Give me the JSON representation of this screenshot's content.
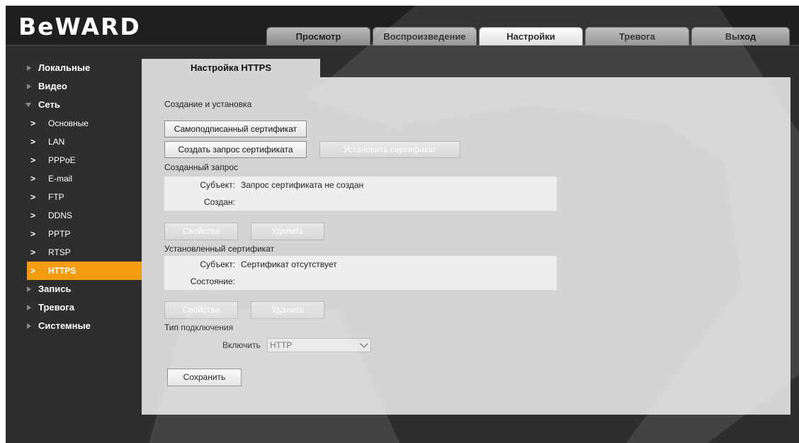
{
  "logo": "BeWARD",
  "tabs": [
    {
      "label": "Просмотр",
      "active": false
    },
    {
      "label": "Воспроизведение",
      "active": false
    },
    {
      "label": "Настройки",
      "active": true
    },
    {
      "label": "Тревога",
      "active": false
    },
    {
      "label": "Выход",
      "active": false
    }
  ],
  "sidebar": {
    "items": [
      {
        "label": "Локальные"
      },
      {
        "label": "Видео"
      },
      {
        "label": "Сеть"
      },
      {
        "label": "Запись"
      },
      {
        "label": "Тревога"
      },
      {
        "label": "Системные"
      }
    ],
    "network_sub": [
      {
        "label": "Основные"
      },
      {
        "label": "LAN"
      },
      {
        "label": "PPPoE"
      },
      {
        "label": "E-mail"
      },
      {
        "label": "FTP"
      },
      {
        "label": "DDNS"
      },
      {
        "label": "PPTP"
      },
      {
        "label": "RTSP"
      },
      {
        "label": "HTTPS"
      }
    ]
  },
  "content": {
    "tab_title": "Настройка HTTPS",
    "section_create": "Создание и установка",
    "btn_selfsigned": "Самоподписанный сертификат",
    "btn_create_request": "Создать запрос сертификата",
    "btn_install": "Установить сертификат",
    "section_request": "Созданный запрос",
    "request": {
      "subject_key": "Субъект:",
      "subject_val": "Запрос сертификата не создан",
      "created_key": "Создан:",
      "created_val": ""
    },
    "btn_properties": "Свойства",
    "btn_delete": "Удалить",
    "section_installed": "Установленный сертификат",
    "installed": {
      "subject_key": "Субъект:",
      "subject_val": "Сертификат отсутствует",
      "state_key": "Состояние:",
      "state_val": ""
    },
    "section_conn": "Тип подключения",
    "enable_label": "Включить",
    "enable_value": "HTTP",
    "btn_save": "Сохранить"
  },
  "colors": {
    "accent": "#f39c12",
    "background": "#2e2e2e",
    "panel": "#d4d4d4"
  }
}
